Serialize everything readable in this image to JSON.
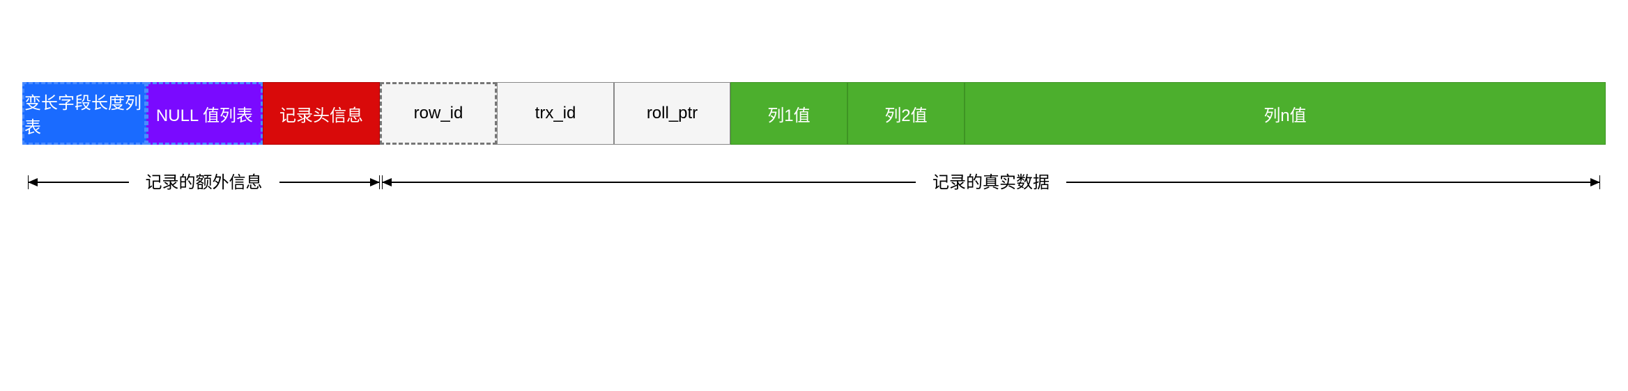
{
  "cells": {
    "varlen": "变长字段长度列表",
    "nulllist": "NULL 值列表",
    "header": "记录头信息",
    "rowid": "row_id",
    "trxid": "trx_id",
    "rollptr": "roll_ptr",
    "col1": "列1值",
    "col2": "列2值",
    "coln": "列n值"
  },
  "annotations": {
    "extra": "记录的额外信息",
    "real": "记录的真实数据"
  }
}
